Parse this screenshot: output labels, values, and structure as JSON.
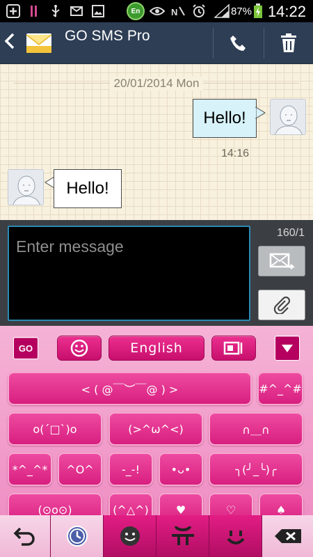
{
  "status_bar": {
    "en_badge": "En",
    "battery_percent": "87%",
    "time": "14:22"
  },
  "header": {
    "title": "GO SMS Pro"
  },
  "conversation": {
    "date_separator": "20/01/2014 Mon",
    "messages": [
      {
        "direction": "sent",
        "text": "Hello!",
        "time": "14:16"
      },
      {
        "direction": "received",
        "text": "Hello!"
      }
    ]
  },
  "composer": {
    "placeholder": "Enter message",
    "char_counter": "160/1"
  },
  "keyboard": {
    "go_label": "GO",
    "language_label": "English",
    "keys": [
      {
        "label": "< ( @￣︶￣@ ) >"
      },
      {
        "label": "#^_^#"
      },
      {
        "label": "o(ˊ□ˋ)o"
      },
      {
        "label": "(>^ω^<)"
      },
      {
        "label": "∩＿∩"
      },
      {
        "label": "*^_^*"
      },
      {
        "label": "^O^"
      },
      {
        "label": "-_-!"
      },
      {
        "label": "•ᴗ•"
      },
      {
        "label": "╮(╯_╰)╭"
      },
      {
        "label": "(⊙o⊙)"
      },
      {
        "label": "(^△^)"
      },
      {
        "label": "♥"
      },
      {
        "label": "♡"
      },
      {
        "label": "♠"
      }
    ]
  },
  "colors": {
    "action_bar": "#2d3e55",
    "keyboard_pink": "#e21d84",
    "sent_bubble": "#d7f2f8",
    "input_border": "#2a8ab4"
  }
}
